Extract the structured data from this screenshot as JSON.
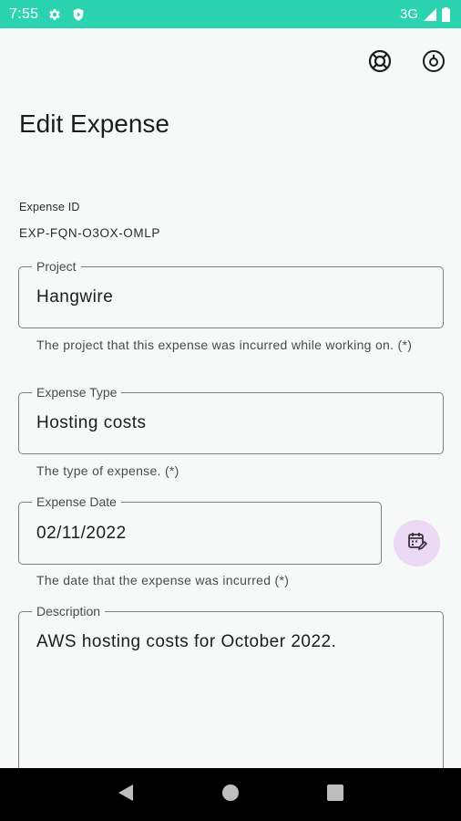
{
  "status_bar": {
    "time": "7:55",
    "network": "3G",
    "icons": [
      "settings-icon",
      "shield-play-icon",
      "signal-icon",
      "battery-icon"
    ],
    "color": "#2bd3b1"
  },
  "toolbar": {
    "icons": [
      "help-lifebuoy-icon",
      "save-disk-icon"
    ]
  },
  "page": {
    "title": "Edit Expense"
  },
  "expense_id": {
    "label": "Expense ID",
    "value": "EXP-FQN-O3OX-OMLP"
  },
  "form": {
    "project": {
      "label": "Project",
      "value": "Hangwire",
      "helper": "The project that this expense was incurred while working on. (*)"
    },
    "expense_type": {
      "label": "Expense Type",
      "value": "Hosting costs",
      "helper": "The type of expense. (*)"
    },
    "expense_date": {
      "label": "Expense Date",
      "value": "02/11/2022",
      "helper": "The date that the expense was incurred (*)",
      "picker_icon": "calendar-edit-icon",
      "picker_color": "#ecd9f4"
    },
    "description": {
      "label": "Description",
      "value": "AWS hosting costs for October 2022."
    }
  },
  "nav_bar": {
    "icons": [
      "back-triangle-icon",
      "home-circle-icon",
      "recents-square-icon"
    ]
  }
}
